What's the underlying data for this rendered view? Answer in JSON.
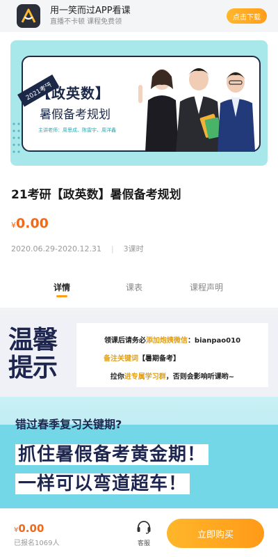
{
  "app_banner": {
    "title": "用一笑而过APP看课",
    "subtitle": "直播不卡顿 课程免费领",
    "download_label": "点击下载"
  },
  "cover": {
    "ribbon": "2021考研",
    "heading": "【政英数】",
    "subheading": "暑假备考规划",
    "teachers": "主讲老师：周思成、陈雷宇、周洋鑫"
  },
  "course": {
    "title": "21考研【政英数】暑假备考规划",
    "price_currency": "¥",
    "price_value": "0.00",
    "date_range": "2020.06.29-2020.12.31",
    "separator": "|",
    "lessons": "3课时"
  },
  "tabs": [
    {
      "label": "详情",
      "active": true
    },
    {
      "label": "课表",
      "active": false
    },
    {
      "label": "课程声明",
      "active": false
    }
  ],
  "tips": {
    "big_1": "温馨",
    "big_2": "提示",
    "line1_a": "领课后请务必",
    "line1_b": "添加炮姨微信",
    "line1_c": "：bianpao010",
    "line2_a": "备注关键词",
    "line2_b": "【暑期备考】",
    "line3_a": "拉你",
    "line3_b": "进专属学习群",
    "line3_c": "，否则会影响听课哟~"
  },
  "promo": {
    "question": "错过春季复习关键期?",
    "line1": "抓住暑假备考黄金期！",
    "line2": "一样可以弯道超车！"
  },
  "bottom_bar": {
    "price_currency": "¥",
    "price_value": "0.00",
    "enrolled": "已报名1069人",
    "service_label": "客服",
    "buy_label": "立即购买"
  },
  "colors": {
    "accent": "#ff9d1a",
    "price": "#f06a1c",
    "navy": "#1e2650",
    "cover_bg": "#a9e8ea"
  }
}
